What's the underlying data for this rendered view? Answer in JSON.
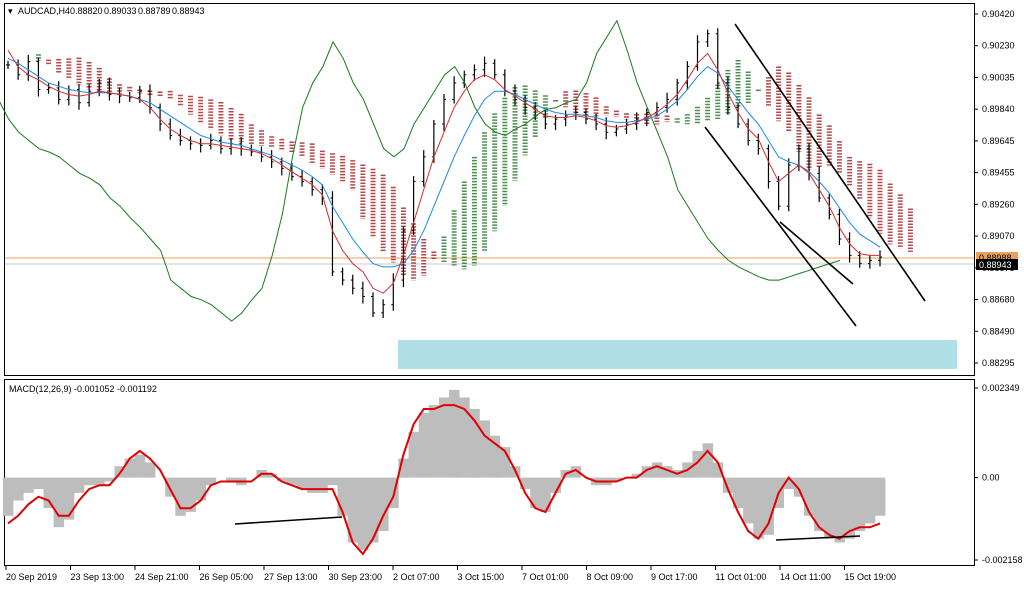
{
  "chart_data": [
    {
      "type": "line",
      "panel": "price",
      "header": {
        "symbol": "AUDCAD,H4",
        "ohlc": [
          "0.88820",
          "0.89033",
          "0.88789",
          "0.88943"
        ]
      },
      "y_ticks": [
        "0.90420",
        "0.90230",
        "0.90035",
        "0.89840",
        "0.89645",
        "0.89455",
        "0.89260",
        "0.89070",
        "0.88875",
        "0.88680",
        "0.88490",
        "0.88295"
      ],
      "ylim": [
        0.88295,
        0.9042
      ],
      "markers": {
        "upper": "0.88988",
        "lower": "0.88943"
      },
      "series": [
        {
          "values": [
            0.9011,
            0.9005,
            0.9013,
            0.8996,
            0.8997,
            0.899,
            0.8996,
            0.8988,
            0.8995,
            0.9,
            0.8993,
            0.8992,
            0.8991,
            0.8995,
            0.8985,
            0.8975,
            0.8968,
            0.8965,
            0.8963,
            0.8962,
            0.8965,
            0.896,
            0.8963,
            0.896,
            0.8958,
            0.8955,
            0.8952,
            0.8948,
            0.8943,
            0.894,
            0.8935,
            0.893,
            0.8885,
            0.888,
            0.8875,
            0.887,
            0.886,
            0.8865,
            0.888,
            0.891,
            0.894,
            0.8955,
            0.8975,
            0.899,
            0.9,
            0.9005,
            0.9008,
            0.9012,
            0.9005,
            0.8995,
            0.899,
            0.8985,
            0.898,
            0.8975,
            0.8978,
            0.898,
            0.8982,
            0.8978,
            0.8975,
            0.897,
            0.8972,
            0.8975,
            0.8978,
            0.8982,
            0.8985,
            0.899,
            0.9,
            0.901,
            0.9025,
            0.903,
            0.9,
            0.8985,
            0.8975,
            0.8965,
            0.896,
            0.894,
            0.8925,
            0.895,
            0.896,
            0.8945,
            0.893,
            0.892,
            0.8905,
            0.8895,
            0.889,
            0.8892,
            0.8894
          ]
        },
        {
          "values": [
            0.902,
            0.901,
            0.9005,
            0.9002,
            0.8998,
            0.8995,
            0.8993,
            0.8992,
            0.8993,
            0.8995,
            0.8994,
            0.8993,
            0.8992,
            0.899,
            0.8985,
            0.8978,
            0.8972,
            0.8968,
            0.8965,
            0.8963,
            0.8963,
            0.8962,
            0.8961,
            0.896,
            0.8959,
            0.8957,
            0.8954,
            0.895,
            0.8946,
            0.8942,
            0.8938,
            0.8932,
            0.891,
            0.8898,
            0.889,
            0.8885,
            0.8875,
            0.8872,
            0.8878,
            0.8895,
            0.8915,
            0.8935,
            0.8955,
            0.897,
            0.8985,
            0.8995,
            0.9002,
            0.9005,
            0.9002,
            0.8996,
            0.8992,
            0.8988,
            0.8984,
            0.898,
            0.8979,
            0.8979,
            0.898,
            0.8979,
            0.8977,
            0.8974,
            0.8973,
            0.8974,
            0.8976,
            0.8979,
            0.8982,
            0.8987,
            0.8993,
            0.9002,
            0.9012,
            0.9018,
            0.9008,
            0.8994,
            0.8982,
            0.8972,
            0.8966,
            0.8952,
            0.894,
            0.8945,
            0.895,
            0.8945,
            0.8935,
            0.8925,
            0.8912,
            0.8902,
            0.8896,
            0.8895,
            0.8895
          ]
        },
        {
          "values": [
            0.9015,
            0.9012,
            0.9008,
            0.9004,
            0.9,
            0.8998,
            0.8996,
            0.8995,
            0.8994,
            0.8994,
            0.8994,
            0.8993,
            0.8992,
            0.899,
            0.8988,
            0.8984,
            0.898,
            0.8976,
            0.8972,
            0.8968,
            0.8966,
            0.8964,
            0.8963,
            0.8962,
            0.896,
            0.8958,
            0.8956,
            0.8953,
            0.895,
            0.8947,
            0.8943,
            0.8938,
            0.8925,
            0.8915,
            0.8905,
            0.8897,
            0.889,
            0.8888,
            0.8888,
            0.889,
            0.8898,
            0.891,
            0.8925,
            0.894,
            0.8955,
            0.8968,
            0.898,
            0.899,
            0.8995,
            0.8995,
            0.8993,
            0.899,
            0.8987,
            0.8984,
            0.8982,
            0.8981,
            0.8981,
            0.898,
            0.8979,
            0.8977,
            0.8976,
            0.8976,
            0.8977,
            0.8978,
            0.898,
            0.8984,
            0.8989,
            0.8996,
            0.9004,
            0.901,
            0.9006,
            0.8998,
            0.899,
            0.8982,
            0.8975,
            0.8965,
            0.8955,
            0.8952,
            0.895,
            0.8946,
            0.894,
            0.8933,
            0.8924,
            0.8915,
            0.8908,
            0.8904,
            0.89
          ]
        },
        {
          "values": [
            0.8985,
            0.898,
            0.8975,
            0.899,
            0.8978,
            0.897,
            0.8965,
            0.896,
            0.8958,
            0.8955,
            0.895,
            0.8945,
            0.8942,
            0.8938,
            0.893,
            0.8925,
            0.8918,
            0.8912,
            0.8905,
            0.8898,
            0.888,
            0.8875,
            0.887,
            0.8868,
            0.8865,
            0.886,
            0.8855,
            0.886,
            0.8868,
            0.8875,
            0.8895,
            0.892,
            0.8955,
            0.8985,
            0.9,
            0.901,
            0.9025,
            0.9015,
            0.9,
            0.899,
            0.8975,
            0.896,
            0.8955,
            0.896,
            0.8975,
            0.8985,
            0.8995,
            0.9005,
            0.901,
            0.9,
            0.8985,
            0.8975,
            0.897,
            0.8968,
            0.8972,
            0.8975,
            0.898,
            0.8984,
            0.8985,
            0.8988,
            0.899,
            0.9,
            0.9018,
            0.9028,
            0.9038,
            0.902,
            0.9,
            0.8985,
            0.897,
            0.8955,
            0.8935,
            0.8925,
            0.8915,
            0.8905,
            0.8898,
            0.8892,
            0.8888,
            0.8885,
            0.8882,
            0.888,
            0.888,
            0.8882,
            0.8884,
            0.8886,
            0.8888,
            0.889,
            0.8892
          ]
        }
      ]
    },
    {
      "type": "bar",
      "panel": "macd",
      "title": "MACD(12,26,9) -0.001052 -0.001192",
      "y_ticks": [
        "0.002349",
        "0.00",
        "-0.002158"
      ],
      "ylim": [
        -0.002158,
        0.002349
      ],
      "x_ticks": [
        "20 Sep 2019",
        "23 Sep 13:00",
        "24 Sep 21:00",
        "26 Sep 05:00",
        "27 Sep 13:00",
        "30 Sep 23:00",
        "2 Oct 07:00",
        "3 Oct 15:00",
        "7 Oct 01:00",
        "8 Oct 09:00",
        "9 Oct 17:00",
        "11 Oct 01:00",
        "14 Oct 11:00",
        "15 Oct 19:00"
      ],
      "series": [
        {
          "values": [
            -0.001,
            -0.0006,
            -0.0004,
            -0.0003,
            -0.0008,
            -0.0013,
            -0.0011,
            -0.0004,
            -0.0002,
            -0.0002,
            -0.0001,
            0.0003,
            0.0005,
            0.0006,
            0.0004,
            0.0,
            -0.0005,
            -0.001,
            -0.0009,
            -0.0006,
            -0.0002,
            0.0,
            -0.0001,
            -0.0002,
            0.0,
            0.0002,
            0.0001,
            -0.0001,
            -0.0002,
            -0.0003,
            -0.0004,
            -0.0004,
            -0.0002,
            -0.001,
            -0.0017,
            -0.0019,
            -0.0017,
            -0.0014,
            -0.0008,
            0.0005,
            0.0012,
            0.0017,
            0.0019,
            0.0021,
            0.0023,
            0.0021,
            0.0018,
            0.0015,
            0.0011,
            0.0008,
            0.0003,
            -0.0003,
            -0.0008,
            -0.0009,
            -0.0004,
            0.0002,
            0.0003,
            0.0,
            -0.0002,
            -0.0002,
            -0.0001,
            0.0,
            0.0001,
            0.0003,
            0.0004,
            0.0003,
            0.0002,
            0.0004,
            0.0007,
            0.0009,
            0.0004,
            -0.0004,
            -0.0008,
            -0.0012,
            -0.0016,
            -0.0015,
            -0.0008,
            -0.0003,
            -0.0005,
            -0.001,
            -0.0014,
            -0.0016,
            -0.0017,
            -0.0016,
            -0.0014,
            -0.0012,
            -0.001
          ]
        },
        {
          "values": [
            -0.0012,
            -0.001,
            -0.0007,
            -0.0005,
            -0.0006,
            -0.001,
            -0.001,
            -0.0006,
            -0.0003,
            -0.0002,
            -0.0002,
            0.0001,
            0.0005,
            0.0007,
            0.0005,
            0.0002,
            -0.0003,
            -0.0008,
            -0.0008,
            -0.0006,
            -0.0002,
            -0.0001,
            -0.0001,
            -0.0001,
            -0.0001,
            0.0001,
            0.0001,
            -0.0001,
            -0.0002,
            -0.0003,
            -0.0003,
            -0.0003,
            -0.0003,
            -0.0009,
            -0.0017,
            -0.002,
            -0.0016,
            -0.001,
            -0.0005,
            0.0006,
            0.0014,
            0.0018,
            0.0018,
            0.0019,
            0.0019,
            0.0018,
            0.0015,
            0.0011,
            0.0009,
            0.0007,
            0.0002,
            -0.0004,
            -0.0008,
            -0.0009,
            -0.0004,
            0.0001,
            0.0002,
            0.0,
            -0.0001,
            -0.0001,
            -0.0001,
            0.0,
            0.0,
            0.0002,
            0.0003,
            0.0002,
            0.0001,
            0.0002,
            0.0004,
            0.0007,
            0.0004,
            -0.0003,
            -0.0009,
            -0.0014,
            -0.0016,
            -0.0012,
            -0.0004,
            0.0,
            -0.0003,
            -0.0009,
            -0.0013,
            -0.0015,
            -0.0016,
            -0.0014,
            -0.0013,
            -0.0013,
            -0.0012
          ]
        }
      ]
    }
  ]
}
